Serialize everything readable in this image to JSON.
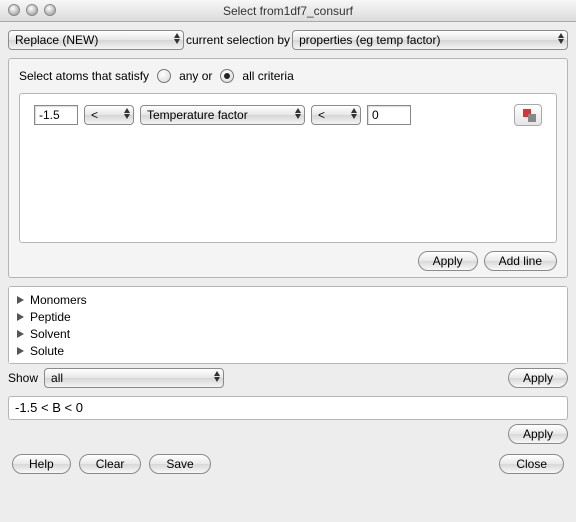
{
  "window": {
    "title": "Select from1df7_consurf"
  },
  "toprow": {
    "action": "Replace (NEW)",
    "midtext": "current selection by",
    "method": "properties (eg temp factor)"
  },
  "criteria": {
    "prompt_left": "Select atoms that satisfy",
    "any_label": "any or",
    "all_label": "all criteria",
    "line": {
      "val_lo": "-1.5",
      "op1": "<",
      "prop": "Temperature factor",
      "op2": "<",
      "val_hi": "0"
    },
    "apply": "Apply",
    "addline": "Add line"
  },
  "tree": {
    "items": [
      "Monomers",
      "Peptide",
      "Solvent",
      "Solute"
    ]
  },
  "show": {
    "label": "Show",
    "value": "all",
    "apply": "Apply"
  },
  "expr": {
    "text": "-1.5 < B < 0",
    "apply": "Apply"
  },
  "footer": {
    "help": "Help",
    "clear": "Clear",
    "save": "Save",
    "close": "Close"
  }
}
